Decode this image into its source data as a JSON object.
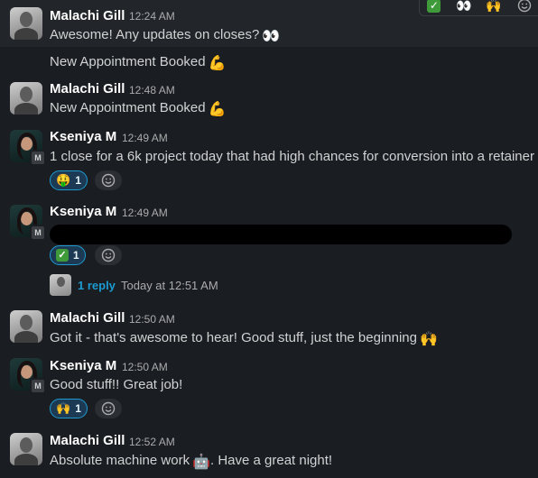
{
  "toolbar": {
    "icons": [
      "check-mark-icon",
      "eyes-icon",
      "raised-hands-icon",
      "add-reaction-icon"
    ]
  },
  "messages": [
    {
      "author": "Malachi Gill",
      "time": "12:24 AM",
      "text": "Awesome! Any updates on closes?",
      "emoji": "eyes"
    },
    {
      "text": "New Appointment Booked",
      "emoji": "flexed-biceps"
    },
    {
      "author": "Malachi Gill",
      "time": "12:48 AM",
      "text": "New Appointment Booked",
      "emoji": "flexed-biceps"
    },
    {
      "author": "Kseniya M",
      "badge": "M",
      "time": "12:49 AM",
      "text": "1 close for a 6k project today that had high chances for conversion into a retainer",
      "reaction": {
        "emoji": "money-mouth-face",
        "count": "1"
      }
    },
    {
      "author": "Kseniya M",
      "badge": "M",
      "time": "12:49 AM",
      "text_redacted": true,
      "reaction": {
        "emoji": "check-mark",
        "count": "1"
      },
      "thread": {
        "reply_label": "1 reply",
        "time_label": "Today at 12:51 AM"
      }
    },
    {
      "author": "Malachi Gill",
      "time": "12:50 AM",
      "text": "Got it - that's awesome to hear! Good stuff, just the beginning",
      "emoji": "raised-hands"
    },
    {
      "author": "Kseniya M",
      "badge": "M",
      "time": "12:50 AM",
      "text": "Good stuff!! Great job!",
      "reaction": {
        "emoji": "raised-hands",
        "count": "1"
      }
    },
    {
      "author": "Malachi Gill",
      "time": "12:52 AM",
      "text_before": "Absolute machine work",
      "emoji": "robot",
      "text_after": ". Have a great night!"
    }
  ],
  "colors": {
    "background": "#1a1d21",
    "hover_background": "#222529",
    "link": "#1d9bd1",
    "reaction_bg": "#1d3a55"
  }
}
